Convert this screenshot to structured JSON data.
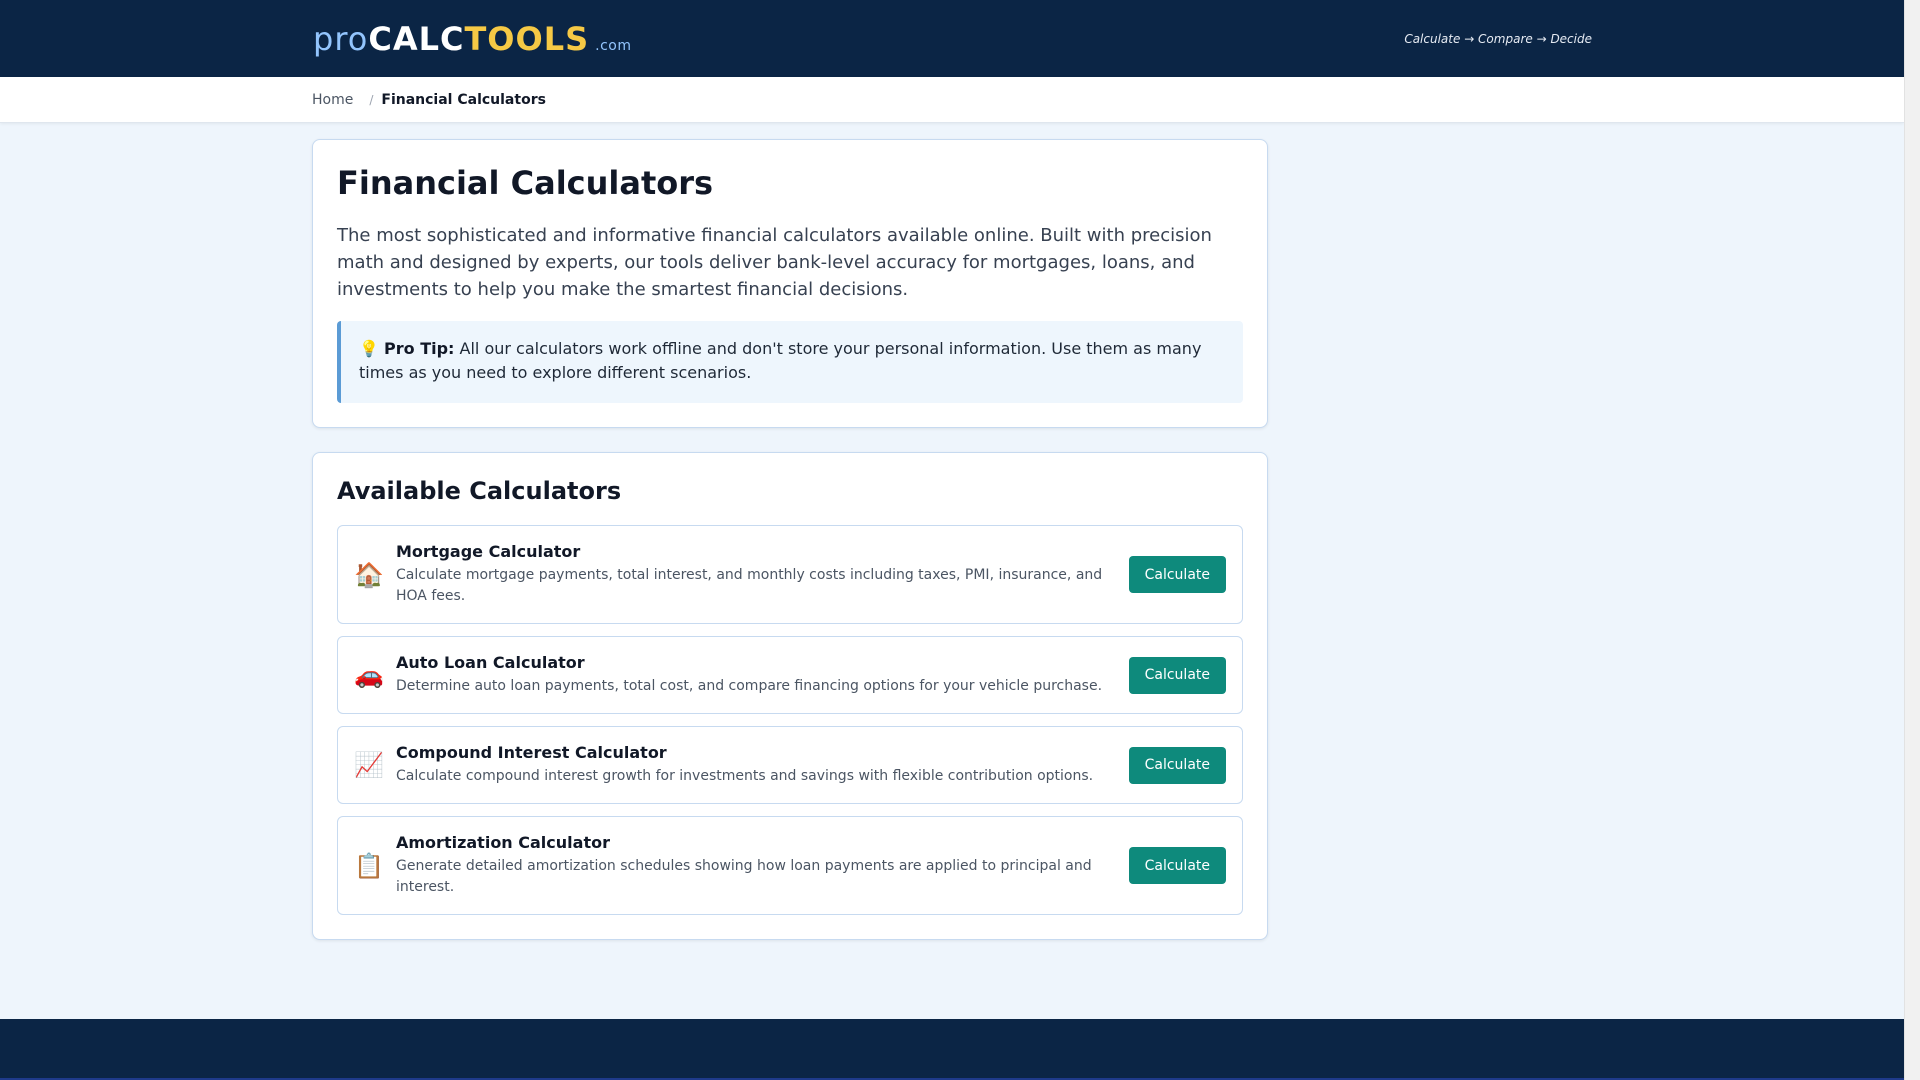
{
  "header": {
    "logo_pro": "pro",
    "logo_calc": "CALC",
    "logo_tools": "TOOLS",
    "logo_com": ".com",
    "tagline": "Calculate → Compare → Decide"
  },
  "breadcrumb": {
    "home": "Home",
    "separator": "/",
    "current": "Financial Calculators"
  },
  "intro": {
    "title": "Financial Calculators",
    "description": "The most sophisticated and informative financial calculators available online. Built with precision math and designed by experts, our tools deliver bank-level accuracy for mortgages, loans, and investments to help you make the smartest financial decisions.",
    "tip_icon": "💡",
    "tip_label": "Pro Tip:",
    "tip_text": " All our calculators work offline and don't store your personal information. Use them as many times as you need to explore different scenarios."
  },
  "calculators": {
    "title": "Available Calculators",
    "items": [
      {
        "icon": "🏠",
        "name": "Mortgage Calculator",
        "description": "Calculate mortgage payments, total interest, and monthly costs including taxes, PMI, insurance, and HOA fees.",
        "button": "Calculate"
      },
      {
        "icon": "🚗",
        "name": "Auto Loan Calculator",
        "description": "Determine auto loan payments, total cost, and compare financing options for your vehicle purchase.",
        "button": "Calculate"
      },
      {
        "icon": "📈",
        "name": "Compound Interest Calculator",
        "description": "Calculate compound interest growth for investments and savings with flexible contribution options.",
        "button": "Calculate"
      },
      {
        "icon": "📋",
        "name": "Amortization Calculator",
        "description": "Generate detailed amortization schedules showing how loan payments are applied to principal and interest.",
        "button": "Calculate"
      }
    ]
  }
}
